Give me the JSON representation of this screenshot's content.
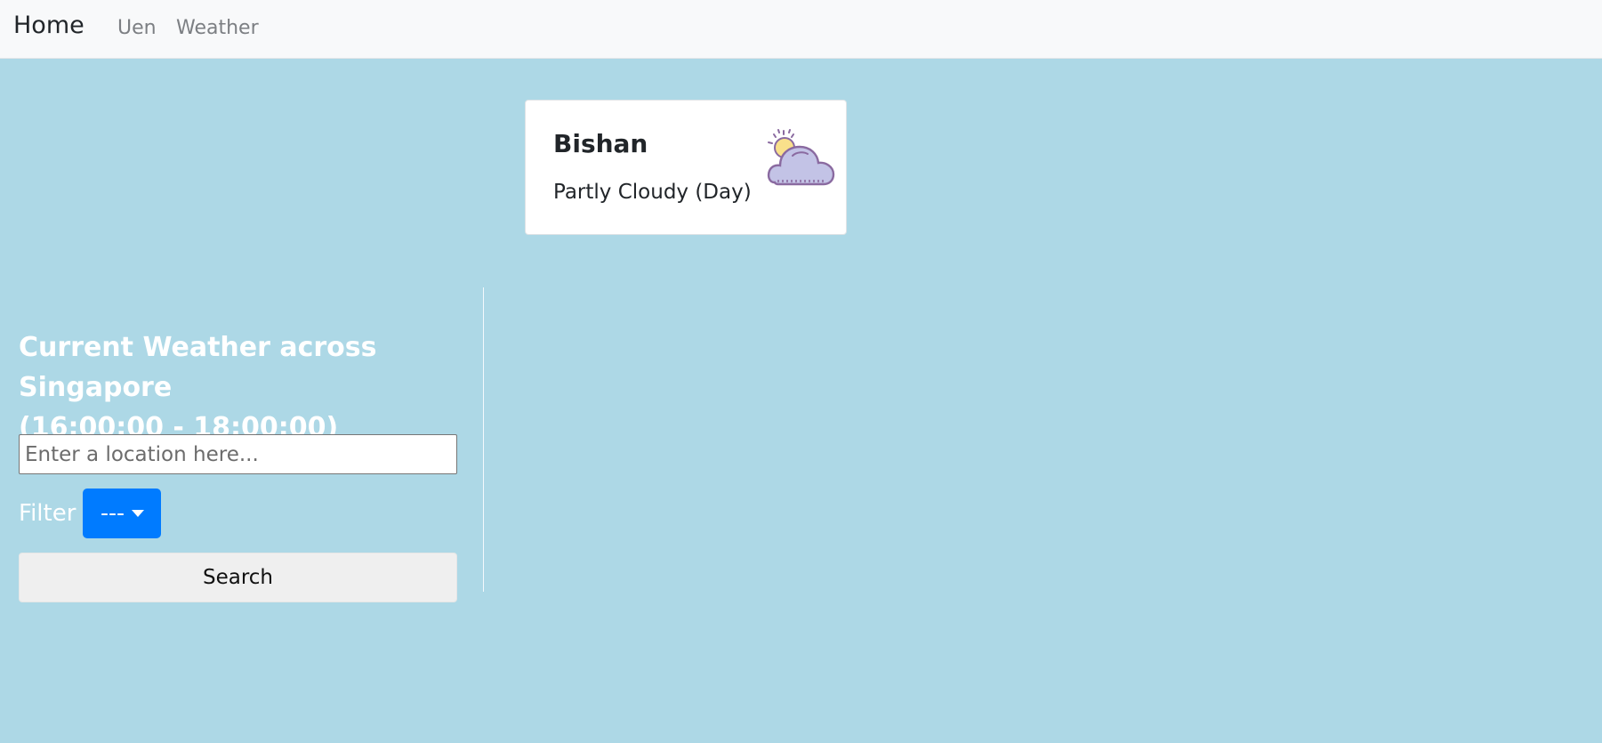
{
  "navbar": {
    "brand": "Home",
    "links": [
      "Uen",
      "Weather"
    ]
  },
  "card": {
    "location": "Bishan",
    "forecast": "Partly Cloudy (Day)",
    "icon": "partly-cloudy-day-icon"
  },
  "panel": {
    "heading_line1": "Current Weather across Singapore",
    "heading_line2": "(16:00:00 - 18:00:00)",
    "search_placeholder": "Enter a location here...",
    "filter_label": "Filter :",
    "filter_value": "---",
    "search_button": "Search"
  },
  "colors": {
    "page_background": "#add8e6",
    "navbar_background": "#f8f9fa",
    "filter_button": "#007bff",
    "card_background": "#ffffff"
  }
}
